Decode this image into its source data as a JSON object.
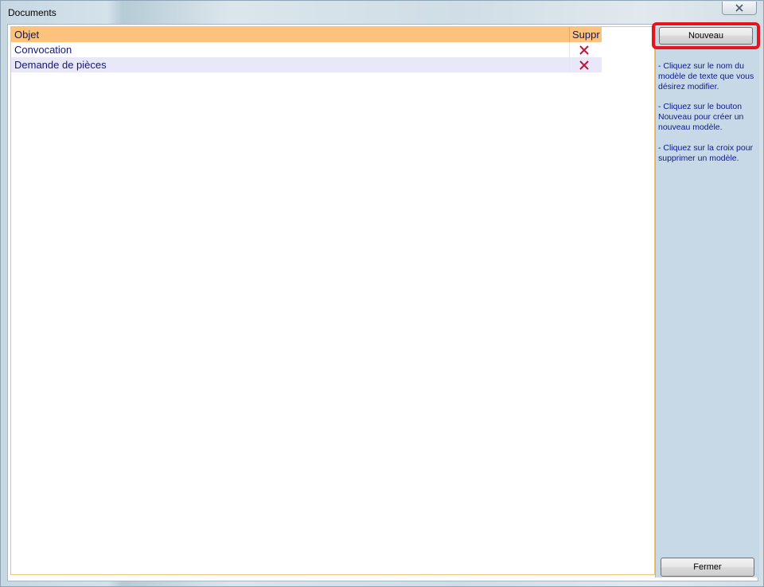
{
  "window": {
    "title": "Documents"
  },
  "list": {
    "columns": {
      "objet": "Objet",
      "suppr": "Suppr"
    },
    "rows": [
      {
        "label": "Convocation"
      },
      {
        "label": "Demande de pièces"
      }
    ]
  },
  "buttons": {
    "nouveau": "Nouveau",
    "fermer": "Fermer"
  },
  "help": [
    "- Cliquez sur le nom du modèle de texte que vous désirez modifier.",
    "- Cliquez sur le bouton Nouveau pour créer un nouveau modèle.",
    "- Cliquez sur la croix pour supprimer un modèle."
  ],
  "colors": {
    "header_bg": "#fdc27b",
    "row_alt_bg": "#e8e8f8",
    "text": "#14177a",
    "delete_icon": "#c0163c",
    "highlight": "#e8141c",
    "side_panel": "#c7d8e7"
  },
  "icons": {
    "delete": "close-x-icon",
    "window_close": "close-icon"
  }
}
